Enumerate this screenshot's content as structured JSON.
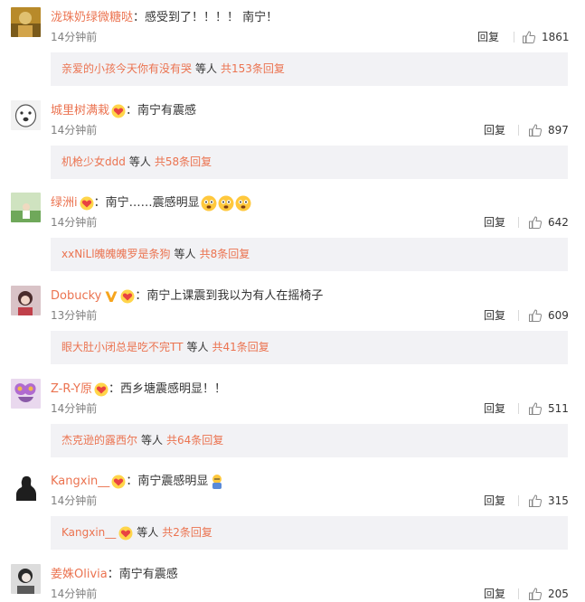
{
  "colors": {
    "accent": "#eb7350",
    "text": "#333333",
    "muted": "#808080",
    "box": "#f2f2f5"
  },
  "comments": [
    {
      "name": "泷珠奶绿微糖哒",
      "text": "：感受到了！！！！ 南宁！",
      "time": "14分钟前",
      "reply_label": "回复",
      "likes": "1861",
      "replies": {
        "replier": "亲爱的小孩今天你有没有哭",
        "etc": "等人",
        "count": "共153条回复"
      }
    },
    {
      "name": "城里树满栽",
      "text": "：南宁有震感",
      "time": "14分钟前",
      "reply_label": "回复",
      "likes": "897",
      "replies": {
        "replier": "机枪少女ddd",
        "etc": "等人",
        "count": "共58条回复"
      }
    },
    {
      "name": "绿洲i",
      "text": "：南宁……震感明显",
      "time": "14分钟前",
      "reply_label": "回复",
      "likes": "642",
      "replies": {
        "replier": "xxNiLl魄魄魄罗是条狗",
        "etc": "等人",
        "count": "共8条回复"
      }
    },
    {
      "name": "Dobucky",
      "text": "：南宁上课震到我以为有人在摇椅子",
      "time": "13分钟前",
      "reply_label": "回复",
      "likes": "609",
      "replies": {
        "replier": "眼大肚小闭总是吃不完TT",
        "etc": "等人",
        "count": "共41条回复"
      }
    },
    {
      "name": "Z-R-Y原",
      "text": "：西乡塘震感明显！！",
      "time": "14分钟前",
      "reply_label": "回复",
      "likes": "511",
      "replies": {
        "replier": "杰克逊的露西尔",
        "etc": "等人",
        "count": "共64条回复"
      }
    },
    {
      "name": "Kangxin__",
      "text": "：南宁震感明显",
      "time": "14分钟前",
      "reply_label": "回复",
      "likes": "315",
      "replies": {
        "replier": "Kangxin__",
        "etc": "等人",
        "count": "共2条回复"
      }
    },
    {
      "name": "姜姝Olivia",
      "text": "：南宁有震感",
      "time": "14分钟前",
      "reply_label": "回复",
      "likes": "205"
    }
  ]
}
